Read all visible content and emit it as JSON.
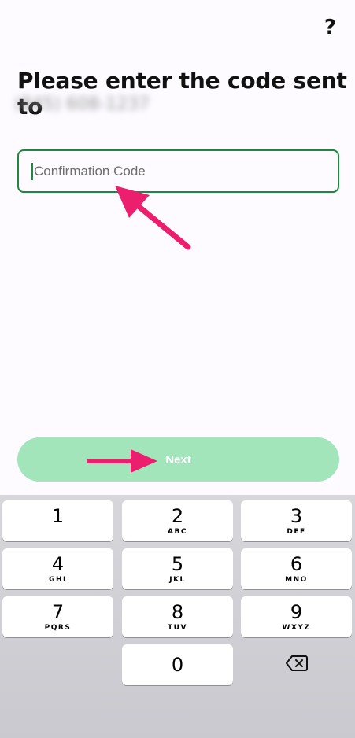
{
  "header": {
    "help_label": "?"
  },
  "title": "Please enter the code sent to",
  "phone_blurred": "(845) 608-1237",
  "code_field": {
    "placeholder": "Confirmation Code",
    "value": ""
  },
  "next_label": "Next",
  "keypad": {
    "keys": [
      {
        "num": "1",
        "letters": ""
      },
      {
        "num": "2",
        "letters": "ABC"
      },
      {
        "num": "3",
        "letters": "DEF"
      },
      {
        "num": "4",
        "letters": "GHI"
      },
      {
        "num": "5",
        "letters": "JKL"
      },
      {
        "num": "6",
        "letters": "MNO"
      },
      {
        "num": "7",
        "letters": "PQRS"
      },
      {
        "num": "8",
        "letters": "TUV"
      },
      {
        "num": "9",
        "letters": "WXYZ"
      },
      {
        "num": "0",
        "letters": ""
      }
    ],
    "backspace_icon": "backspace-icon"
  },
  "colors": {
    "accent_green": "#1b8a3c",
    "button_green": "#a2e5bb",
    "annotation_pink": "#ec1e6e"
  }
}
